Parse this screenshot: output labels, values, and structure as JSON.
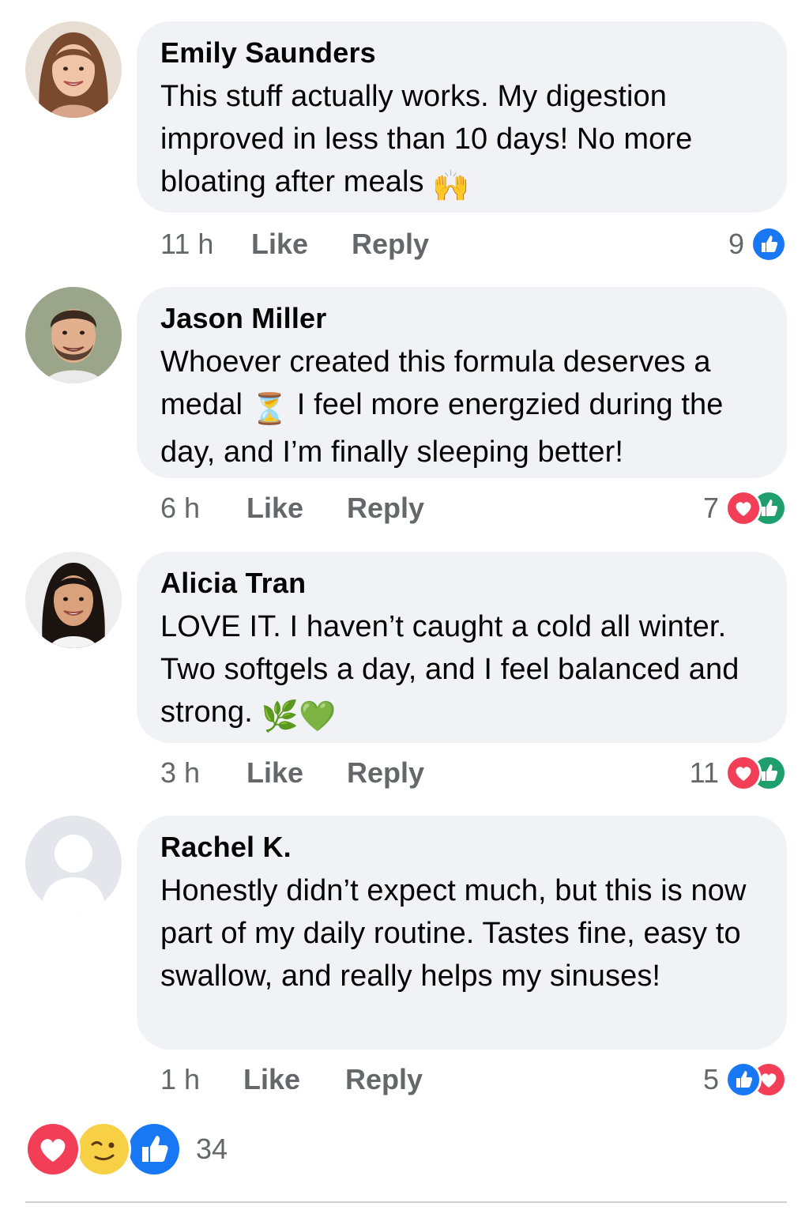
{
  "comments": [
    {
      "author": "Emily Saunders",
      "text": "This stuff actually works. My digestion improved in less than 10 days! No more bloating after meals",
      "emoji": "🙌",
      "time": "11 h",
      "like_label": "Like",
      "reply_label": "Reply",
      "reaction_count": "9",
      "reactions": [
        "like-icon"
      ]
    },
    {
      "author": "Jason Miller",
      "text_before": "Whoever created this formula deserves a medal",
      "emoji": "⏳",
      "text_after": "I feel more energzied during the day, and I’m finally sleeping better!",
      "time": "6 h",
      "like_label": "Like",
      "reply_label": "Reply",
      "reaction_count": "7",
      "reactions": [
        "love-icon",
        "like-icon"
      ]
    },
    {
      "author": "Alicia Tran",
      "text": "LOVE IT. I haven’t caught a cold all winter. Two softgels a day, and I feel balanced and strong.",
      "emoji": "🌿💚",
      "time": "3 h",
      "like_label": "Like",
      "reply_label": "Reply",
      "reaction_count": "11",
      "reactions": [
        "love-icon",
        "like-icon"
      ]
    },
    {
      "author": "Rachel K.",
      "text": "Honestly didn’t expect much, but this is now part of my daily routine. Tastes fine, easy to swallow, and really helps my sinuses!",
      "time": "1 h",
      "like_label": "Like",
      "reply_label": "Reply",
      "reaction_count": "5",
      "reactions": [
        "like-icon",
        "love-icon"
      ]
    }
  ],
  "summary": {
    "reactions": [
      "love-icon",
      "wink-icon",
      "like-icon"
    ],
    "total": "34"
  },
  "colors": {
    "bubble": "#f0f2f5",
    "meta_text": "#65676b",
    "like_blue": "#1877f2",
    "love_red": "#f33e58",
    "haha_yellow": "#f7d046",
    "divider": "#ced0d4"
  }
}
